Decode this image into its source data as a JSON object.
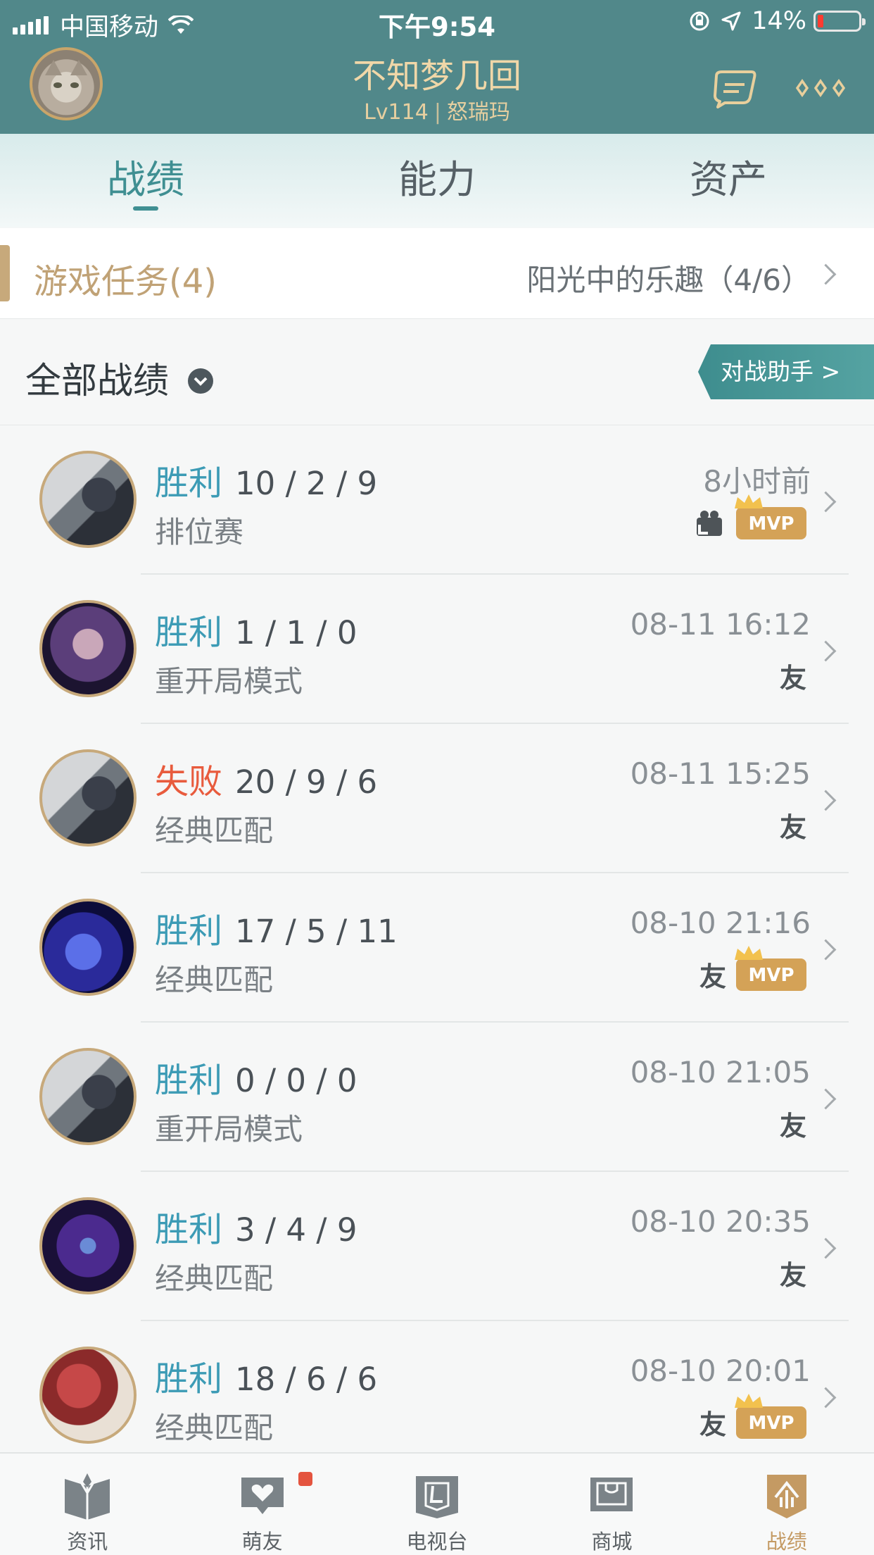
{
  "status_bar": {
    "carrier": "中国移动",
    "time": "下午9:54",
    "battery": "14%"
  },
  "profile": {
    "name": "不知梦几回",
    "level": "Lv114",
    "rank": "怒瑞玛"
  },
  "tabs": [
    {
      "label": "战绩",
      "active": true
    },
    {
      "label": "能力",
      "active": false
    },
    {
      "label": "资产",
      "active": false
    }
  ],
  "task": {
    "title": "游戏任务(4)",
    "detail": "阳光中的乐趣（4/6）"
  },
  "section": {
    "title": "全部战绩",
    "assist_button": "对战助手 >"
  },
  "badges": {
    "friend": "友",
    "mvp": "MVP"
  },
  "matches": [
    {
      "result": "胜利",
      "kda": "10 / 2 / 9",
      "mode": "排位赛",
      "time": "8小时前",
      "win": true,
      "friend": false,
      "mvp": true,
      "replay": true,
      "hero_icon": "camille"
    },
    {
      "result": "胜利",
      "kda": "1 / 1 / 0",
      "mode": "重开局模式",
      "time": "08-11 16:12",
      "win": true,
      "friend": true,
      "mvp": false,
      "replay": false,
      "hero_icon": "kaisa"
    },
    {
      "result": "失败",
      "kda": "20 / 9 / 6",
      "mode": "经典匹配",
      "time": "08-11 15:25",
      "win": false,
      "friend": true,
      "mvp": false,
      "replay": false,
      "hero_icon": "camille"
    },
    {
      "result": "胜利",
      "kda": "17 / 5 / 11",
      "mode": "经典匹配",
      "time": "08-10 21:16",
      "win": true,
      "friend": true,
      "mvp": true,
      "replay": false,
      "hero_icon": "aurelion"
    },
    {
      "result": "胜利",
      "kda": "0 / 0 / 0",
      "mode": "重开局模式",
      "time": "08-10 21:05",
      "win": true,
      "friend": true,
      "mvp": false,
      "replay": false,
      "hero_icon": "camille"
    },
    {
      "result": "胜利",
      "kda": "3 / 4 / 9",
      "mode": "经典匹配",
      "time": "08-10 20:35",
      "win": true,
      "friend": true,
      "mvp": false,
      "replay": false,
      "hero_icon": "kassadin"
    },
    {
      "result": "胜利",
      "kda": "18 / 6 / 6",
      "mode": "经典匹配",
      "time": "08-10 20:01",
      "win": true,
      "friend": true,
      "mvp": true,
      "replay": false,
      "hero_icon": "lee"
    }
  ],
  "bottom_nav": [
    {
      "label": "资讯",
      "icon": "book-icon",
      "active": false,
      "dot": false
    },
    {
      "label": "萌友",
      "icon": "heart-chat-icon",
      "active": false,
      "dot": true
    },
    {
      "label": "电视台",
      "icon": "tv-icon",
      "active": false,
      "dot": false
    },
    {
      "label": "商城",
      "icon": "shop-icon",
      "active": false,
      "dot": false
    },
    {
      "label": "战绩",
      "icon": "record-icon",
      "active": true,
      "dot": false
    }
  ],
  "colors": {
    "header": "#51888a",
    "win": "#3c9bb5",
    "lose": "#e85b3d",
    "gold": "#c7a97b"
  }
}
